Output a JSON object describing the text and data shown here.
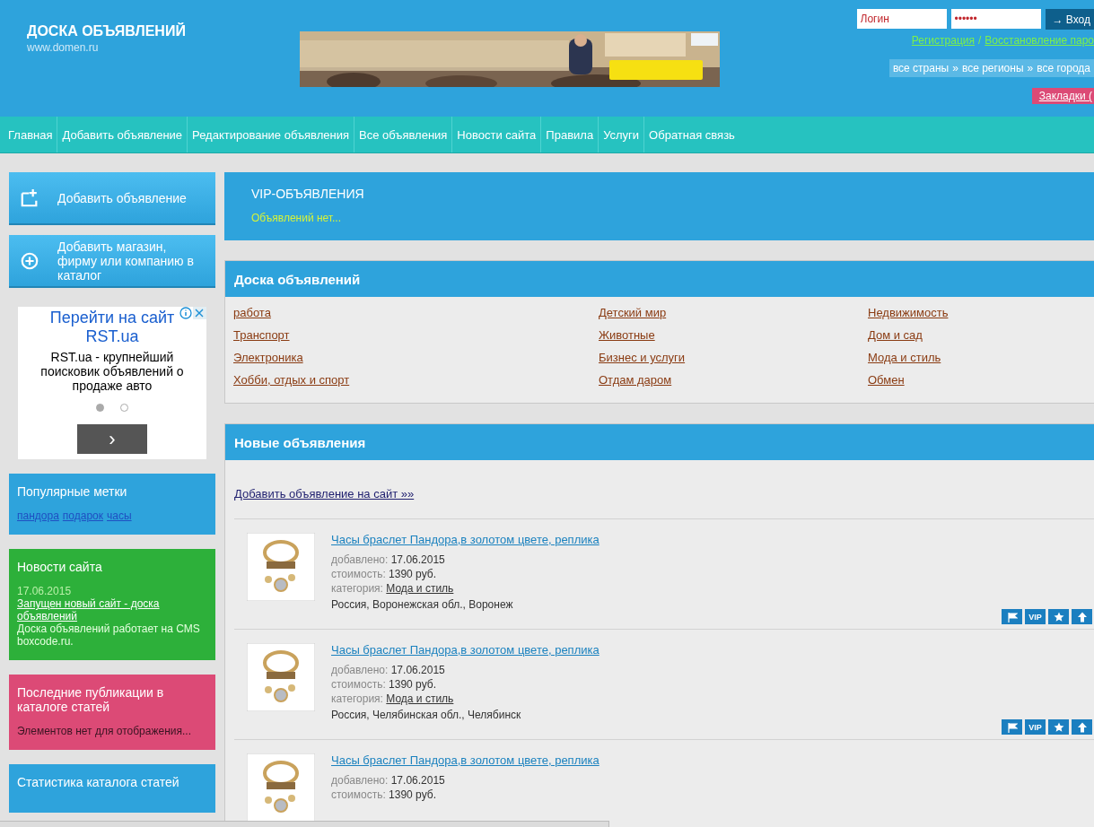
{
  "header": {
    "site_title": "ДОСКА ОБЪЯВЛЕНИЙ",
    "site_url": "www.domen.ru",
    "banner": {
      "kind": "picture"
    },
    "login": {
      "username_placeholder": "Логин",
      "password_value": "••••••",
      "submit": "→ Вход"
    },
    "account_links": [
      {
        "label": "Регистрация"
      },
      {
        "label": "Восстановление паро"
      }
    ],
    "account_separator": "/",
    "location": [
      "все страны",
      "все регионы",
      "все города"
    ],
    "location_separator": "»",
    "bookmarks": "Закладки ("
  },
  "nav": [
    {
      "label": "Главная"
    },
    {
      "label": "Добавить объявление"
    },
    {
      "label": "Редактирование объявления"
    },
    {
      "label": "Все объявления"
    },
    {
      "label": "Новости сайта"
    },
    {
      "label": "Правила"
    },
    {
      "label": "Услуги"
    },
    {
      "label": "Обратная связь"
    }
  ],
  "sidebar": {
    "actions": [
      {
        "kind": "add-ad",
        "label": "Добавить объявление"
      },
      {
        "kind": "add-company",
        "label": "Добавить магазин, фирму или компанию в каталог"
      }
    ],
    "ad": {
      "title": "Перейти на сайт RST.ua",
      "text": "RST.ua - крупнейший поисковик объявлений о продаже авто",
      "dots": [
        {
          "selected": true
        },
        {
          "selected": false
        }
      ],
      "next": "›"
    },
    "blocks": [
      {
        "kind": "tags",
        "title": "Популярные метки",
        "color": "#2ea3dc",
        "tags": [
          "пандора",
          "подарок",
          "часы"
        ]
      },
      {
        "kind": "news",
        "title": "Новости сайта",
        "color": "#2db03a",
        "date": "17.06.2015",
        "link": "Запущен новый сайт - доска объявлений",
        "text": "Доска объявлений работает на CMS boxcode.ru."
      },
      {
        "kind": "text",
        "title": "Последние публикации в каталоге статей",
        "color": "#dc4a76",
        "text": "Элементов нет для отображения..."
      },
      {
        "kind": "text",
        "title": "Статистика каталога статей",
        "color": "#2ea3dc"
      }
    ]
  },
  "vip": {
    "title": "VIP-ОБЪЯВЛЕНИЯ",
    "empty": "Объявлений нет..."
  },
  "categories": {
    "title": "Доска объявлений",
    "items": [
      "работа",
      "Детский мир",
      "Недвижимость",
      "Транспорт",
      "Животные",
      "Дом и сад",
      "Электроника",
      "Бизнес и услуги",
      "Мода и стиль",
      "Хобби, отдых и спорт",
      "Отдам даром",
      "Обмен"
    ]
  },
  "new_ads": {
    "title": "Новые объявления",
    "add_link": "Добавить объявление на сайт »»",
    "ads": [
      {
        "title": "Часы браслет Пандора,в золотом цвете, реплика",
        "added_label": "добавлено:",
        "added": "17.06.2015",
        "price_label": "стоимость:",
        "price": "1390 руб.",
        "category_label": "категория:",
        "category": "Мода и стиль",
        "location": "Россия, Воронежская обл., Воронеж",
        "vip": "VIP"
      },
      {
        "title": "Часы браслет Пандора,в золотом цвете, реплика",
        "added_label": "добавлено:",
        "added": "17.06.2015",
        "price_label": "стоимость:",
        "price": "1390 руб.",
        "category_label": "категория:",
        "category": "Мода и стиль",
        "location": "Россия, Челябинская обл., Челябинск",
        "vip": "VIP"
      },
      {
        "title": "Часы браслет Пандора,в золотом цвете, реплика",
        "added_label": "добавлено:",
        "added": "17.06.2015",
        "price_label": "стоимость:",
        "price": "1390 руб."
      }
    ]
  }
}
